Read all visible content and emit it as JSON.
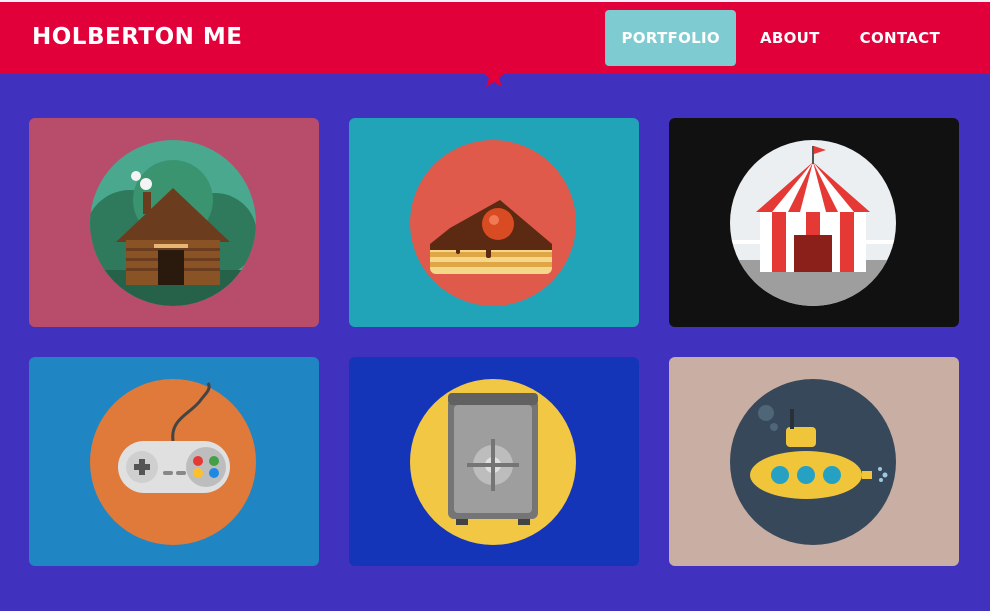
{
  "header": {
    "title": "HOLBERTON ME",
    "nav": [
      {
        "label": "PORTFOLIO",
        "active": true
      },
      {
        "label": "ABOUT",
        "active": false
      },
      {
        "label": "CONTACT",
        "active": false
      }
    ]
  },
  "colors": {
    "background": "#4131bf",
    "header": "#e1003a",
    "active_nav": "#7ecbd1"
  },
  "portfolio": {
    "items": [
      {
        "icon": "log-cabin-icon",
        "card_color": "#b84c6b"
      },
      {
        "icon": "cake-slice-icon",
        "card_color": "#21a4b8"
      },
      {
        "icon": "circus-tent-icon",
        "card_color": "#111111"
      },
      {
        "icon": "game-controller-icon",
        "card_color": "#1f86c3"
      },
      {
        "icon": "safe-icon",
        "card_color": "#1535b8"
      },
      {
        "icon": "submarine-icon",
        "card_color": "#c9afa3"
      }
    ]
  }
}
